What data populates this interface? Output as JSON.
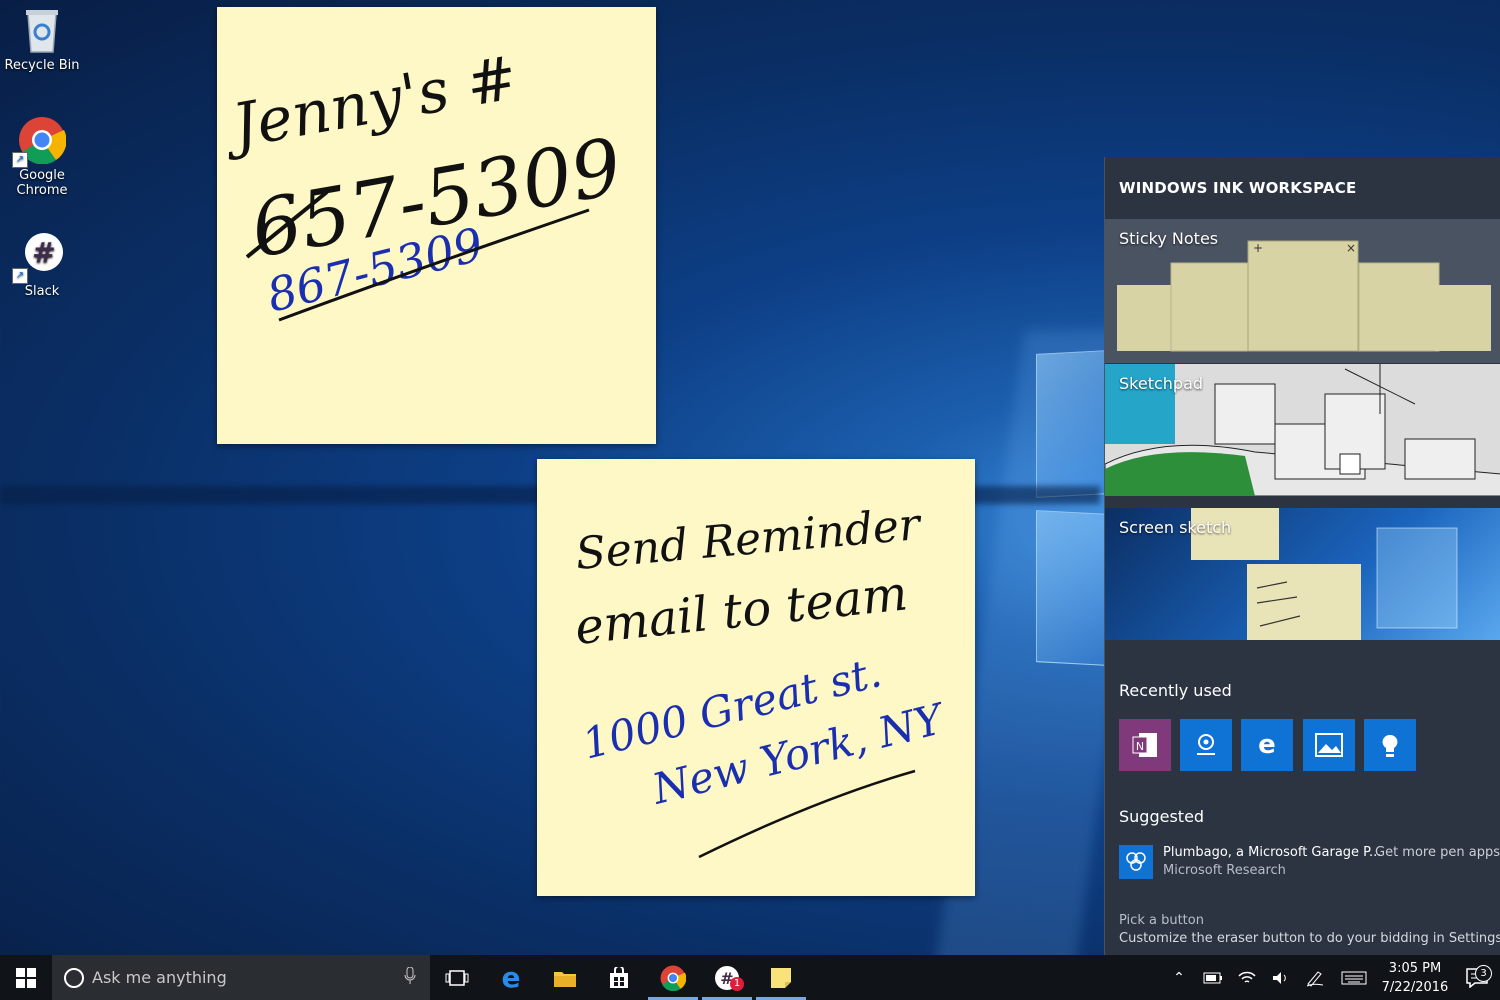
{
  "desktop": {
    "icons": [
      {
        "label": "Recycle Bin"
      },
      {
        "label": "Google\nChrome",
        "line1": "Google",
        "line2": "Chrome"
      },
      {
        "label": "Slack"
      }
    ]
  },
  "notes": [
    {
      "lines": [
        "Jenny's #",
        "657-5309",
        "867-5309"
      ]
    },
    {
      "lines": [
        "Send Reminder",
        "email to team",
        "1000 Great st.",
        "New York, NY"
      ]
    }
  ],
  "ink_workspace": {
    "title": "WINDOWS INK WORKSPACE",
    "tiles": {
      "sticky_notes": "Sticky Notes",
      "sketchpad": "Sketchpad",
      "screen_sketch": "Screen sketch"
    },
    "recently_used_title": "Recently used",
    "recent_apps": [
      "onenote-icon",
      "maps-icon",
      "edge-icon",
      "photos-icon",
      "tips-icon"
    ],
    "suggested_title": "Suggested",
    "suggested_app": {
      "name": "Plumbago, a Microsoft Garage P...",
      "publisher": "Microsoft Research"
    },
    "get_more": "Get more pen apps",
    "tip_title": "Pick a button",
    "tip_text": "Customize the eraser button to do your bidding in Settings"
  },
  "taskbar": {
    "search_placeholder": "Ask me anything",
    "slack_badge": "1",
    "time": "3:05 PM",
    "date": "7/22/2016",
    "notifications_count": "3"
  },
  "colors": {
    "note_yellow": "#fdf8c6",
    "panel_bg": "#2b3440",
    "accent_blue": "#0f73d6",
    "onenote_purple": "#80397b"
  }
}
